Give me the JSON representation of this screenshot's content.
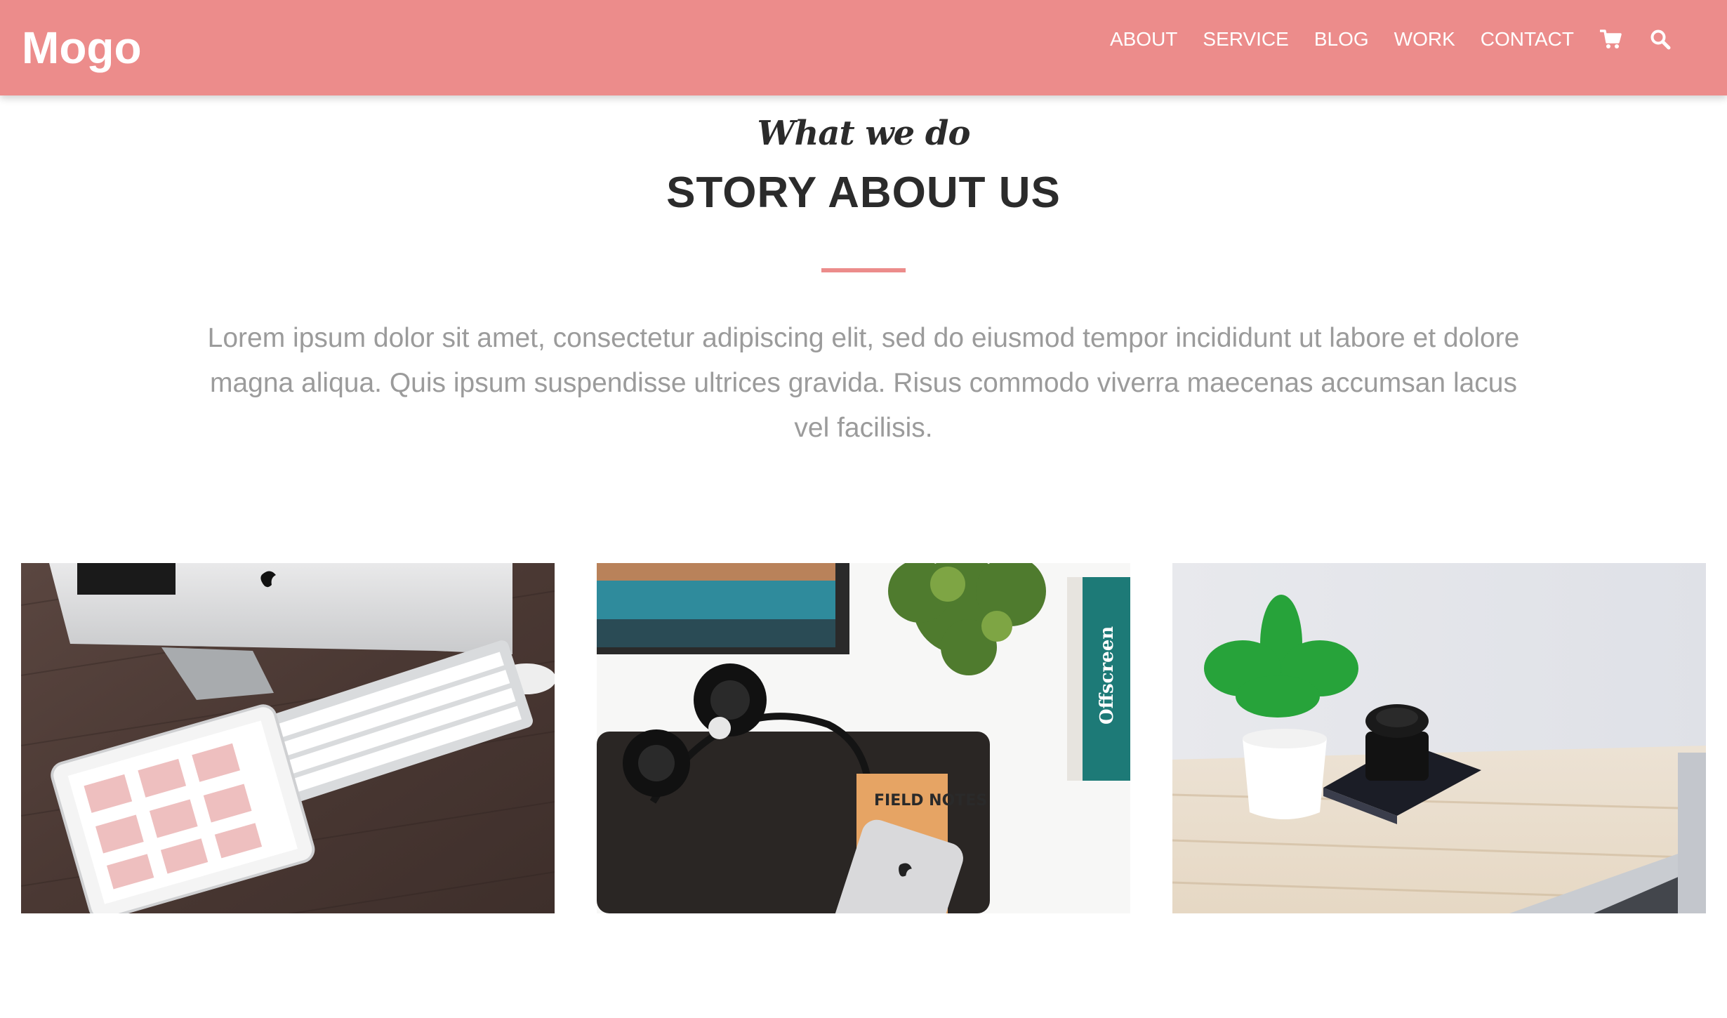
{
  "brand": {
    "logo": "Mogo"
  },
  "nav": {
    "items": [
      {
        "label": "ABOUT"
      },
      {
        "label": "SERVICE"
      },
      {
        "label": "BLOG"
      },
      {
        "label": "WORK"
      },
      {
        "label": "CONTACT"
      }
    ],
    "icons": [
      "cart-icon",
      "search-icon"
    ]
  },
  "section": {
    "eyebrow": "What we do",
    "title": "STORY ABOUT US",
    "lead": "Lorem ipsum dolor sit amet, consectetur adipiscing elit, sed do eiusmod tempor incididunt ut labore et dolore magna aliqua. Quis ipsum suspendisse ultrices gravida. Risus commodo viverra maecenas accumsan lacus vel facilisis."
  },
  "photos": [
    {
      "notebook_text": "FIELD NOTES",
      "book_spine": "Offscreen"
    }
  ],
  "colors": {
    "accent": "#ec8c8b",
    "text_dark": "#2b2b2b",
    "text_muted": "#9b9b9b"
  }
}
